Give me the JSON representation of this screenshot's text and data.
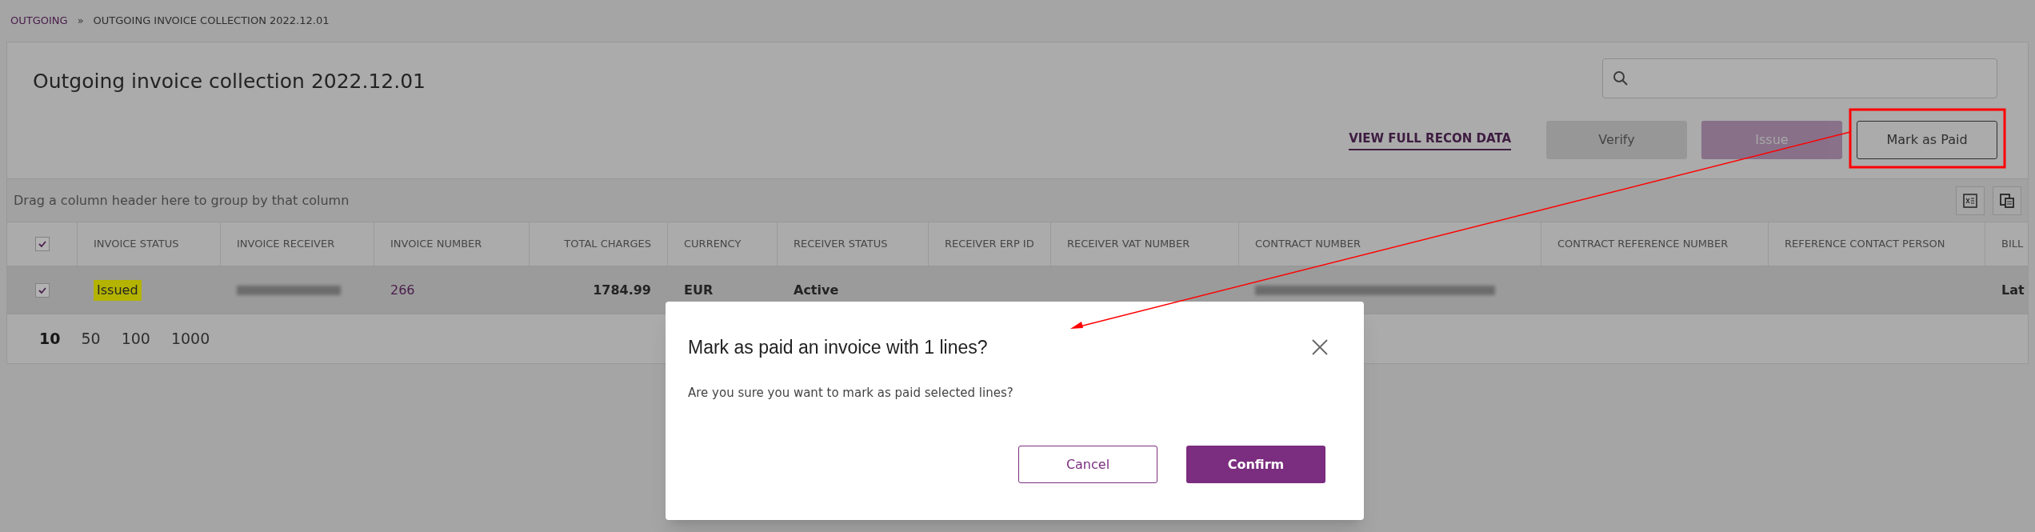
{
  "breadcrumb": [
    {
      "label": "OUTGOING",
      "kind": "link"
    },
    {
      "label": "»",
      "kind": "separator"
    },
    {
      "label": "OUTGOING INVOICE COLLECTION 2022.12.01",
      "kind": "current"
    }
  ],
  "title": "Outgoing invoice collection 2022.12.01",
  "actions": {
    "link": "VIEW FULL RECON DATA",
    "buttons": [
      {
        "label": "Verify",
        "kind": "grey",
        "disabled": true
      },
      {
        "label": "Issue",
        "kind": "primary",
        "disabled": true
      },
      {
        "label": "Mark as Paid",
        "kind": "outline",
        "disabled": false
      }
    ]
  },
  "group_panel": "Drag a column header here to group by that column",
  "table": {
    "header_checked": true,
    "columns": [
      "INVOICE STATUS",
      "INVOICE RECEIVER",
      "INVOICE NUMBER",
      "TOTAL CHARGES",
      "CURRENCY",
      "RECEIVER STATUS",
      "RECEIVER ERP ID",
      "RECEIVER VAT NUMBER",
      "CONTRACT NUMBER",
      "CONTRACT REFERENCE NUMBER",
      "REFERENCE CONTACT PERSON",
      "BILL"
    ],
    "rows": [
      {
        "selected": true,
        "checked": true,
        "status": {
          "label": "Issued",
          "color": "#b3b300"
        },
        "number": "266",
        "total": "1784.99",
        "currency": "EUR",
        "receiver_status": "Active",
        "column_12": "Lat"
      }
    ]
  },
  "page_sizes": [
    {
      "label": "10",
      "selected": true
    },
    {
      "label": "50",
      "selected": false
    },
    {
      "label": "100",
      "selected": false
    },
    {
      "label": "1000",
      "selected": false
    }
  ],
  "dialog": {
    "title": "Mark as paid an invoice with 1 lines?",
    "message": "Are you sure you want to mark as paid selected lines?",
    "buttons": [
      {
        "label": "Cancel",
        "kind": "outline"
      },
      {
        "label": "Confirm",
        "kind": "primary"
      }
    ]
  }
}
